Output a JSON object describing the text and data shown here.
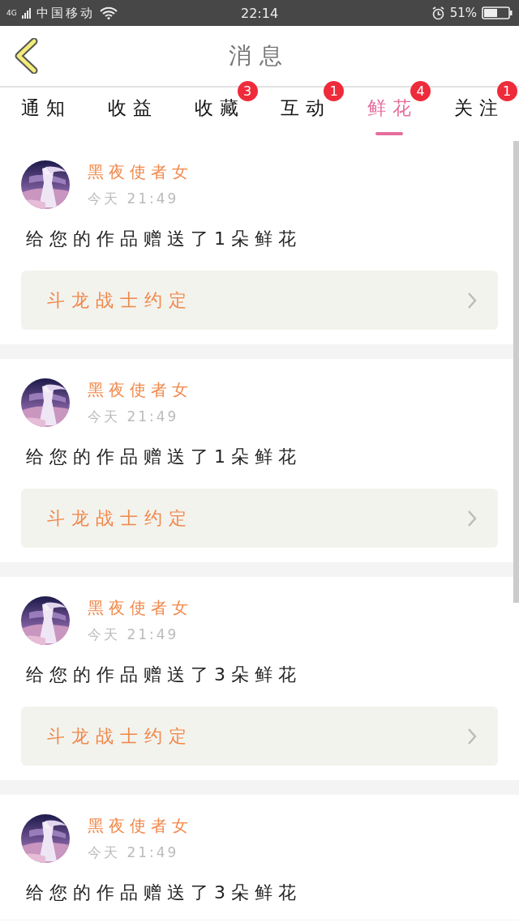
{
  "status_bar": {
    "network": "4G",
    "carrier": "中国移动",
    "time": "22:14",
    "battery": "51%"
  },
  "header": {
    "title": "消息"
  },
  "tabs": [
    {
      "label": "通知",
      "selected": false
    },
    {
      "label": "收益",
      "selected": false
    },
    {
      "label": "收藏",
      "selected": false,
      "badge": "3"
    },
    {
      "label": "互动",
      "selected": false,
      "badge": "1"
    },
    {
      "label": "鲜花",
      "selected": true,
      "badge": "4"
    },
    {
      "label": "关注",
      "selected": false,
      "badge": "1"
    }
  ],
  "messages": [
    {
      "user": "黑夜使者女",
      "time": "今天 21:49",
      "text": "给您的作品赠送了1朵鲜花",
      "work": "斗龙战士约定"
    },
    {
      "user": "黑夜使者女",
      "time": "今天 21:49",
      "text": "给您的作品赠送了1朵鲜花",
      "work": "斗龙战士约定"
    },
    {
      "user": "黑夜使者女",
      "time": "今天 21:49",
      "text": "给您的作品赠送了3朵鲜花",
      "work": "斗龙战士约定"
    },
    {
      "user": "黑夜使者女",
      "time": "今天 21:49",
      "text": "给您的作品赠送了3朵鲜花"
    }
  ]
}
